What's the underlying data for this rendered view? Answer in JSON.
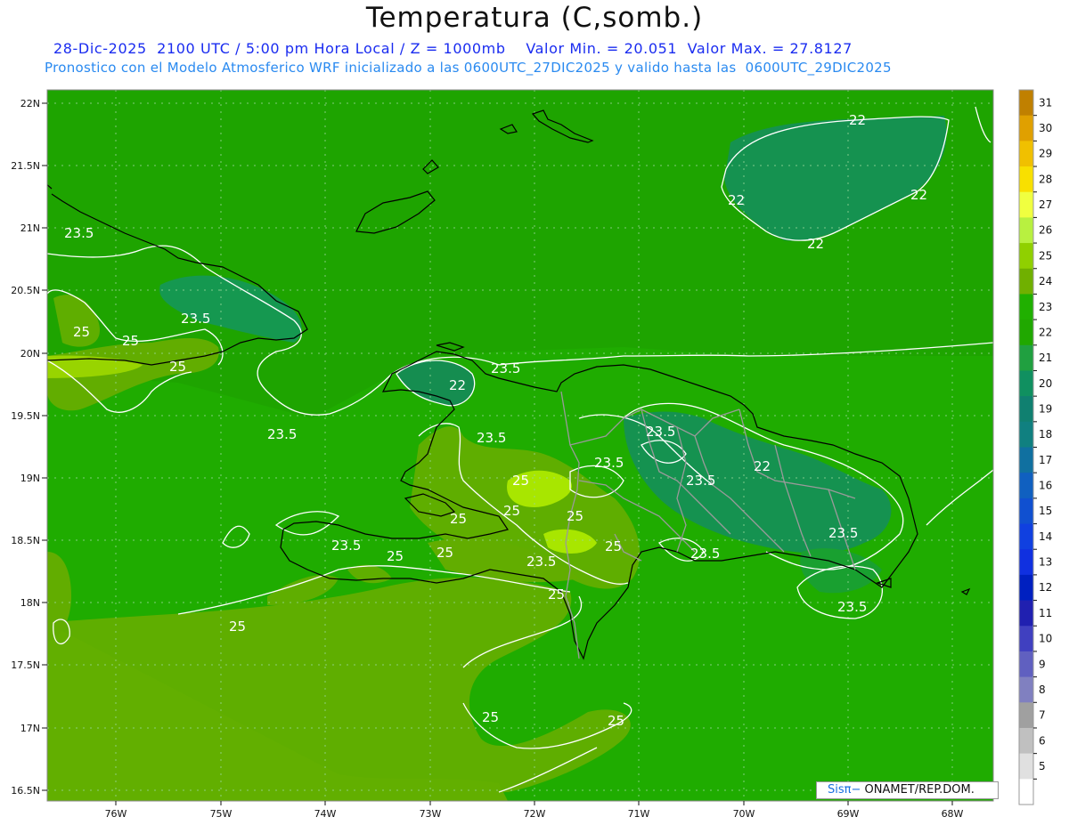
{
  "header": {
    "title": "Temperatura (C,somb.)",
    "line1": "28-Dic-2025  2100 UTC / 5:00 pm Hora Local / Z = 1000mb    Valor Min. = 20.051  Valor Max. = 27.8127",
    "line2": "Pronostico con el Modelo Atmosferico WRF inicializado a las 0600UTC_27DIC2025 y valido hasta las  0600UTC_29DIC2025"
  },
  "axes": {
    "lat_labels": [
      "22N",
      "21.5N",
      "21N",
      "20.5N",
      "20N",
      "19.5N",
      "19N",
      "18.5N",
      "18N",
      "17.5N",
      "17N",
      "16.5N"
    ],
    "lon_labels": [
      "76W",
      "75W",
      "74W",
      "73W",
      "72W",
      "71W",
      "70W",
      "69W",
      "68W"
    ]
  },
  "colorbar": {
    "labels": [
      "31",
      "30",
      "29",
      "28",
      "27",
      "26",
      "25",
      "24",
      "23",
      "22",
      "21",
      "20",
      "19",
      "18",
      "17",
      "16",
      "15",
      "14",
      "13",
      "12",
      "11",
      "10",
      "9",
      "8",
      "7",
      "6",
      "5"
    ],
    "colors": [
      "#c08000",
      "#e0a000",
      "#f0c000",
      "#f8e000",
      "#f0ff40",
      "#b8f040",
      "#90d000",
      "#70b000",
      "#20b000",
      "#20a800",
      "#20a040",
      "#109060",
      "#108070",
      "#108080",
      "#1070a0",
      "#1060c0",
      "#1050d0",
      "#1040e0",
      "#1030e0",
      "#0020c0",
      "#2020b0",
      "#4040c0",
      "#6060c0",
      "#8080c0",
      "#a0a0a0",
      "#c0c0c0",
      "#e0e0e0",
      "#ffffff"
    ]
  },
  "contour_labels": [
    {
      "text": "22"
    },
    {
      "text": "22"
    },
    {
      "text": "22"
    },
    {
      "text": "22"
    },
    {
      "text": "23.5"
    },
    {
      "text": "23.5"
    },
    {
      "text": "25"
    },
    {
      "text": "25"
    },
    {
      "text": "25"
    },
    {
      "text": "23.5"
    },
    {
      "text": "22"
    },
    {
      "text": "23.5"
    },
    {
      "text": "23.5"
    },
    {
      "text": "23.5"
    },
    {
      "text": "23.5"
    },
    {
      "text": "22"
    },
    {
      "text": "23.5"
    },
    {
      "text": "25"
    },
    {
      "text": "25"
    },
    {
      "text": "25"
    },
    {
      "text": "25"
    },
    {
      "text": "25"
    },
    {
      "text": "23.5"
    },
    {
      "text": "25"
    },
    {
      "text": "25"
    },
    {
      "text": "23.5"
    },
    {
      "text": "25"
    },
    {
      "text": "25"
    },
    {
      "text": "23.5"
    },
    {
      "text": "23.5"
    },
    {
      "text": "23.5"
    },
    {
      "text": "25"
    },
    {
      "text": "25"
    },
    {
      "text": "25"
    }
  ],
  "credit": {
    "sis": "Sisπ−",
    "org": "ONAMET/REP.DOM."
  }
}
